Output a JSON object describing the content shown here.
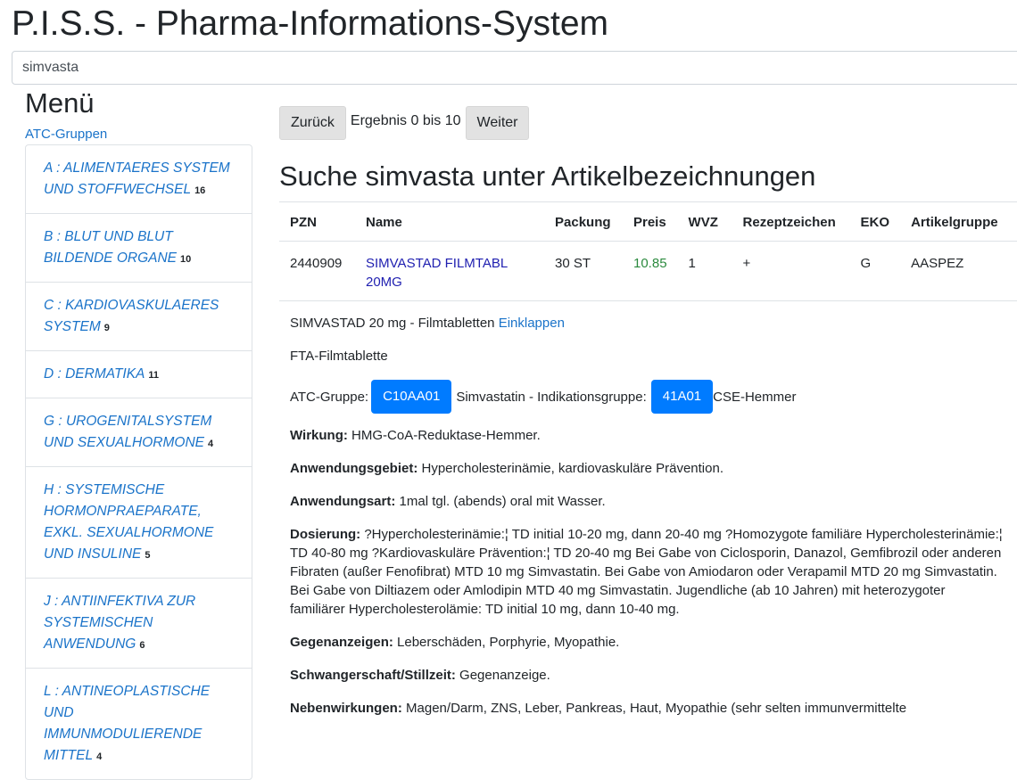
{
  "app": {
    "title": "P.I.S.S. - Pharma-Informations-System"
  },
  "search": {
    "value": "simvasta"
  },
  "sidebar": {
    "heading": "Menü",
    "atc_link": "ATC-Gruppen",
    "items": [
      {
        "label": "A : ALIMENTAERES SYSTEM UND STOFFWECHSEL",
        "count": "16"
      },
      {
        "label": "B : BLUT UND BLUT BILDENDE ORGANE",
        "count": "10"
      },
      {
        "label": "C : KARDIOVASKULAERES SYSTEM",
        "count": "9"
      },
      {
        "label": "D : DERMATIKA",
        "count": "11"
      },
      {
        "label": "G : UROGENITALSYSTEM UND SEXUALHORMONE",
        "count": "4"
      },
      {
        "label": "H : SYSTEMISCHE HORMONPRAEPARATE, EXKL. SEXUALHORMONE UND INSULINE",
        "count": "5"
      },
      {
        "label": "J : ANTIINFEKTIVA ZUR SYSTEMISCHEN ANWENDUNG",
        "count": "6"
      },
      {
        "label": "L : ANTINEOPLASTISCHE UND IMMUNMODULIERENDE MITTEL",
        "count": "4"
      }
    ]
  },
  "pager": {
    "back_label": "Zurück",
    "result_text": "Ergebnis 0 bis 10",
    "next_label": "Weiter"
  },
  "main": {
    "title": "Suche simvasta unter Artikelbezeichnungen"
  },
  "table": {
    "headers": [
      "PZN",
      "Name",
      "Packung",
      "Preis",
      "WVZ",
      "Rezeptzeichen",
      "EKO",
      "Artikelgruppe"
    ],
    "row": {
      "pzn": "2440909",
      "name": "SIMVASTAD FILMTABL 20MG",
      "packung": "30 ST",
      "preis": "10.85",
      "wvz": "1",
      "rezeptzeichen": "+",
      "eko": "G",
      "artikelgruppe": "AASPEZ"
    }
  },
  "details": {
    "product_name": "SIMVASTAD 20 mg - Filmtabletten",
    "collapse_link": "Einklappen",
    "form": "FTA-Filmtablette",
    "atc_label": "ATC-Gruppe:",
    "atc_code": "C10AA01",
    "atc_text": "Simvastatin - Indikationsgruppe:",
    "indication_code": "41A01",
    "indication_text": "CSE-Hemmer",
    "wirkung_label": "Wirkung:",
    "wirkung": "HMG-CoA-Reduktase-Hemmer.",
    "anwendungsgebiet_label": "Anwendungsgebiet:",
    "anwendungsgebiet": "Hypercholesterinämie, kardiovaskuläre Prävention.",
    "anwendungsart_label": "Anwendungsart:",
    "anwendungsart": "1mal tgl. (abends) oral mit Wasser.",
    "dosierung_label": "Dosierung:",
    "dosierung": "?Hypercholesterinämie:¦ TD initial 10-20 mg, dann 20-40 mg ?Homozygote familiäre Hypercholesterinämie:¦ TD 40-80 mg ?Kardiovaskuläre Prävention:¦ TD 20-40 mg Bei Gabe von Ciclosporin, Danazol, Gemfibrozil oder anderen Fibraten (außer Fenofibrat) MTD 10 mg Simvastatin. Bei Gabe von Amiodaron oder Verapamil MTD 20 mg Simvastatin. Bei Gabe von Diltiazem oder Amlodipin MTD 40 mg Simvastatin. Jugendliche (ab 10 Jahren) mit heterozygoter familiärer Hypercholesterolämie: TD initial 10 mg, dann 10-40 mg.",
    "gegenanzeigen_label": "Gegenanzeigen:",
    "gegenanzeigen": "Leberschäden, Porphyrie, Myopathie.",
    "schwangerschaft_label": "Schwangerschaft/Stillzeit:",
    "schwangerschaft": "Gegenanzeige.",
    "nebenwirkungen_label": "Nebenwirkungen:",
    "nebenwirkungen": "Magen/Darm, ZNS, Leber, Pankreas, Haut, Myopathie (sehr selten immunvermittelte"
  }
}
